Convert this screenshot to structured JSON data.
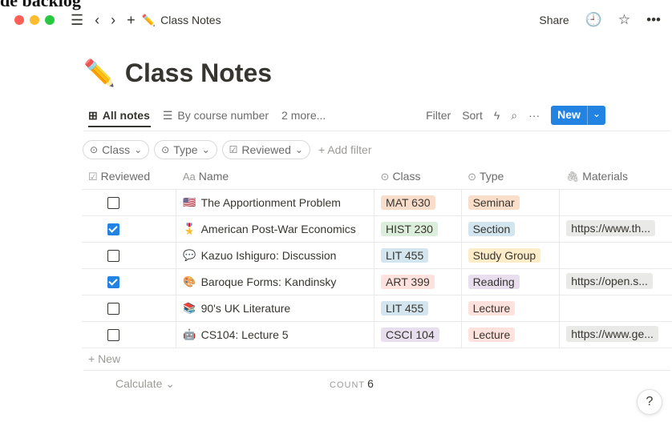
{
  "window": {
    "cut_title": "de backlog",
    "traffic_lights": [
      "#ff5f57",
      "#febc2e",
      "#28c840"
    ]
  },
  "topbar": {
    "icons": [
      "hamburger-icon",
      "back-icon",
      "forward-icon",
      "add-icon"
    ],
    "breadcrumb_emoji": "✏️",
    "breadcrumb": "Class Notes",
    "share": "Share",
    "clock_icon": "🕘",
    "star_icon": "☆",
    "more_icon": "•••"
  },
  "page": {
    "emoji": "✏️",
    "title": "Class Notes"
  },
  "views": {
    "items": [
      {
        "icon": "⊞",
        "label": "All notes"
      },
      {
        "icon": "☰",
        "label": "By course number"
      },
      {
        "label": "2 more..."
      }
    ],
    "filter": "Filter",
    "sort": "Sort",
    "lightning_icon": "ϟ",
    "search_icon": "⌕",
    "more_icon": "···",
    "new": "New",
    "new_chevron": "⌄"
  },
  "filters": [
    {
      "icon": "⊙",
      "label": "Class",
      "chevron": "⌄"
    },
    {
      "icon": "⊙",
      "label": "Type",
      "chevron": "⌄"
    },
    {
      "icon": "☑",
      "label": "Reviewed",
      "chevron": "⌄"
    }
  ],
  "add_filter": "+ Add filter",
  "table": {
    "headers": [
      {
        "icon": "☑",
        "label": "Reviewed"
      },
      {
        "icon": "Aa",
        "label": "Name"
      },
      {
        "icon": "⊙",
        "label": "Class"
      },
      {
        "icon": "⊙",
        "label": "Type"
      },
      {
        "icon": "🖇",
        "label": "Materials"
      }
    ],
    "rows": [
      {
        "reviewed": false,
        "emoji": "🇺🇸",
        "name": "The Apportionment Problem",
        "class": "MAT 630",
        "class_bg": "#f9ddcb",
        "type": "Seminar",
        "type_bg": "#fadec9",
        "materials": ""
      },
      {
        "reviewed": true,
        "emoji": "🎖️",
        "name": "American Post-War Economics",
        "class": "HIST 230",
        "class_bg": "#dbeddb",
        "type": "Section",
        "type_bg": "#d3e5ef",
        "materials": "https://www.th..."
      },
      {
        "reviewed": false,
        "emoji": "💬",
        "name": "Kazuo Ishiguro: Discussion",
        "class": "LIT 455",
        "class_bg": "#d3e5ef",
        "type": "Study Group",
        "type_bg": "#fdecc8",
        "materials": ""
      },
      {
        "reviewed": true,
        "emoji": "🎨",
        "name": "Baroque Forms: Kandinsky",
        "class": "ART 399",
        "class_bg": "#ffe2dd",
        "type": "Reading",
        "type_bg": "#e8deee",
        "materials": "https://open.s..."
      },
      {
        "reviewed": false,
        "emoji": "📚",
        "name": "90's UK Literature",
        "class": "LIT 455",
        "class_bg": "#d3e5ef",
        "type": "Lecture",
        "type_bg": "#ffe2dd",
        "materials": ""
      },
      {
        "reviewed": false,
        "emoji": "🤖",
        "name": "CS104: Lecture 5",
        "class": "CSCI 104",
        "class_bg": "#e8deee",
        "type": "Lecture",
        "type_bg": "#ffe2dd",
        "materials": "https://www.ge..."
      }
    ]
  },
  "new_row": "+ New",
  "footer": {
    "calculate": "Calculate ⌄",
    "count_label": "COUNT",
    "count_value": "6"
  },
  "help": "?"
}
